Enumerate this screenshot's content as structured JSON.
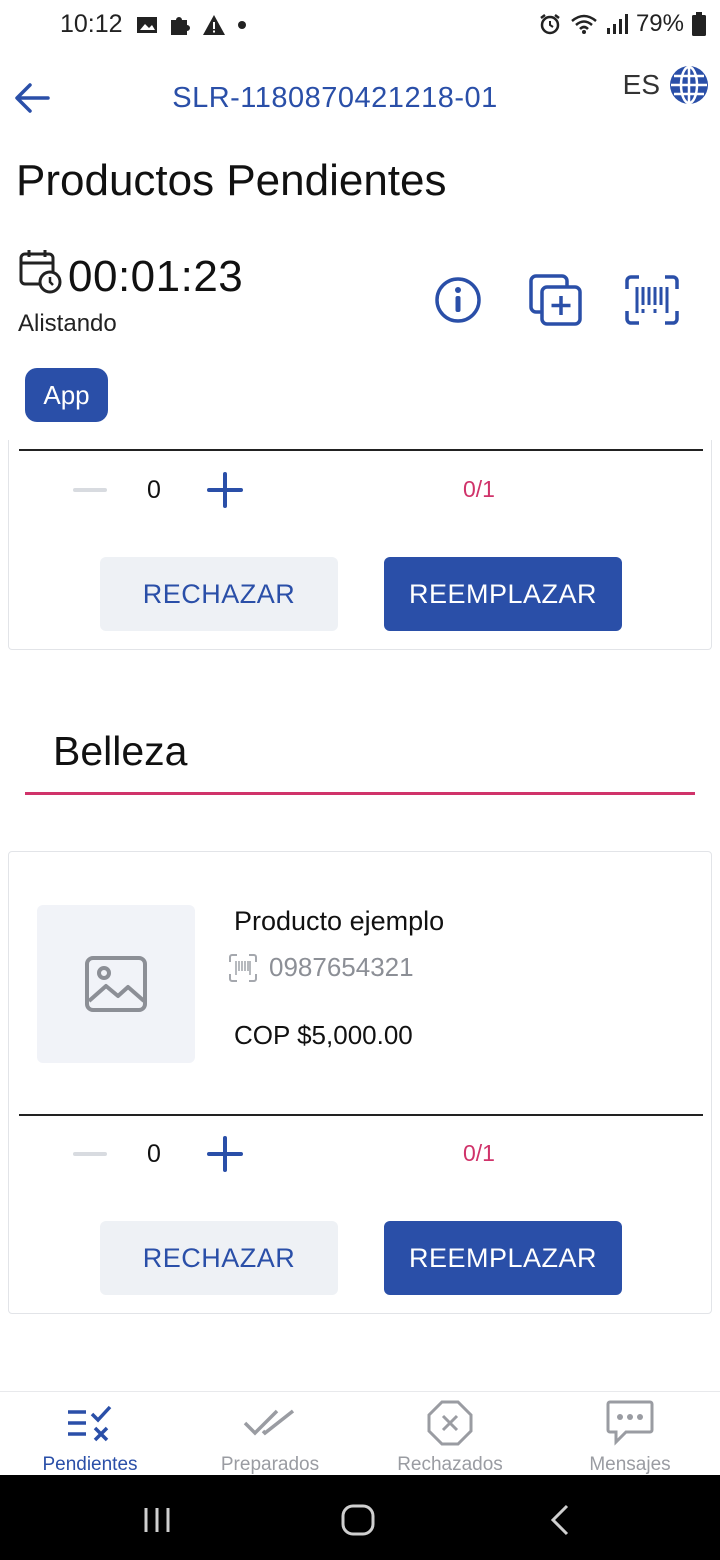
{
  "status_bar": {
    "time": "10:12",
    "battery": "79%"
  },
  "header": {
    "order_id": "SLR-1180870421218-01",
    "language": "ES"
  },
  "page_title": "Productos Pendientes",
  "timer": {
    "value": "00:01:23",
    "status": "Alistando"
  },
  "badge": "App",
  "cards": [
    {
      "quantity": "0",
      "progress": "0/1",
      "reject_label": "RECHAZAR",
      "replace_label": "REEMPLAZAR"
    },
    {
      "product_name": "Producto ejemplo",
      "sku": "0987654321",
      "price": "COP $5,000.00",
      "quantity": "0",
      "progress": "0/1",
      "reject_label": "RECHAZAR",
      "replace_label": "REEMPLAZAR"
    }
  ],
  "category": "Belleza",
  "bottom_nav": [
    {
      "label": "Pendientes",
      "icon": "pending-list-icon",
      "active": true
    },
    {
      "label": "Preparados",
      "icon": "double-check-icon",
      "active": false
    },
    {
      "label": "Rechazados",
      "icon": "octagon-x-icon",
      "active": false
    },
    {
      "label": "Mensajes",
      "icon": "chat-bubble-icon",
      "active": false
    }
  ],
  "colors": {
    "primary": "#2a4fa8",
    "accent": "#d0336a",
    "muted": "#9a9ca2"
  }
}
